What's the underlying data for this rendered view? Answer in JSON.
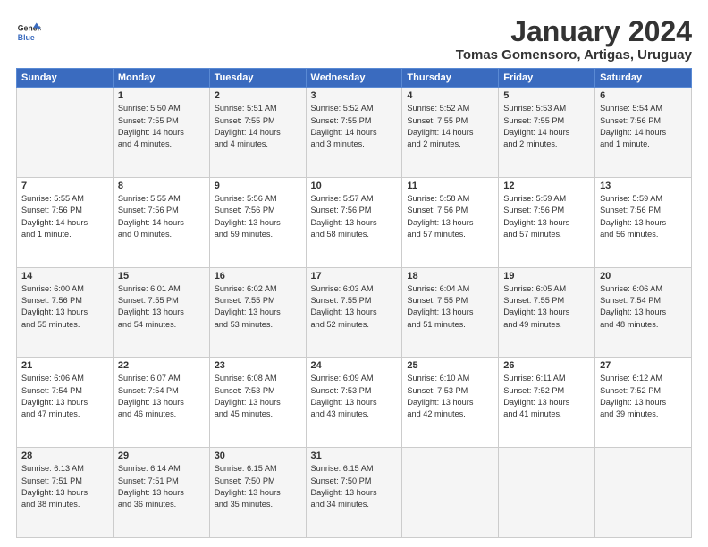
{
  "logo": {
    "line1": "General",
    "line2": "Blue"
  },
  "title": "January 2024",
  "subtitle": "Tomas Gomensoro, Artigas, Uruguay",
  "headers": [
    "Sunday",
    "Monday",
    "Tuesday",
    "Wednesday",
    "Thursday",
    "Friday",
    "Saturday"
  ],
  "rows": [
    [
      {
        "num": "",
        "lines": []
      },
      {
        "num": "1",
        "lines": [
          "Sunrise: 5:50 AM",
          "Sunset: 7:55 PM",
          "Daylight: 14 hours",
          "and 4 minutes."
        ]
      },
      {
        "num": "2",
        "lines": [
          "Sunrise: 5:51 AM",
          "Sunset: 7:55 PM",
          "Daylight: 14 hours",
          "and 4 minutes."
        ]
      },
      {
        "num": "3",
        "lines": [
          "Sunrise: 5:52 AM",
          "Sunset: 7:55 PM",
          "Daylight: 14 hours",
          "and 3 minutes."
        ]
      },
      {
        "num": "4",
        "lines": [
          "Sunrise: 5:52 AM",
          "Sunset: 7:55 PM",
          "Daylight: 14 hours",
          "and 2 minutes."
        ]
      },
      {
        "num": "5",
        "lines": [
          "Sunrise: 5:53 AM",
          "Sunset: 7:55 PM",
          "Daylight: 14 hours",
          "and 2 minutes."
        ]
      },
      {
        "num": "6",
        "lines": [
          "Sunrise: 5:54 AM",
          "Sunset: 7:56 PM",
          "Daylight: 14 hours",
          "and 1 minute."
        ]
      }
    ],
    [
      {
        "num": "7",
        "lines": [
          "Sunrise: 5:55 AM",
          "Sunset: 7:56 PM",
          "Daylight: 14 hours",
          "and 1 minute."
        ]
      },
      {
        "num": "8",
        "lines": [
          "Sunrise: 5:55 AM",
          "Sunset: 7:56 PM",
          "Daylight: 14 hours",
          "and 0 minutes."
        ]
      },
      {
        "num": "9",
        "lines": [
          "Sunrise: 5:56 AM",
          "Sunset: 7:56 PM",
          "Daylight: 13 hours",
          "and 59 minutes."
        ]
      },
      {
        "num": "10",
        "lines": [
          "Sunrise: 5:57 AM",
          "Sunset: 7:56 PM",
          "Daylight: 13 hours",
          "and 58 minutes."
        ]
      },
      {
        "num": "11",
        "lines": [
          "Sunrise: 5:58 AM",
          "Sunset: 7:56 PM",
          "Daylight: 13 hours",
          "and 57 minutes."
        ]
      },
      {
        "num": "12",
        "lines": [
          "Sunrise: 5:59 AM",
          "Sunset: 7:56 PM",
          "Daylight: 13 hours",
          "and 57 minutes."
        ]
      },
      {
        "num": "13",
        "lines": [
          "Sunrise: 5:59 AM",
          "Sunset: 7:56 PM",
          "Daylight: 13 hours",
          "and 56 minutes."
        ]
      }
    ],
    [
      {
        "num": "14",
        "lines": [
          "Sunrise: 6:00 AM",
          "Sunset: 7:56 PM",
          "Daylight: 13 hours",
          "and 55 minutes."
        ]
      },
      {
        "num": "15",
        "lines": [
          "Sunrise: 6:01 AM",
          "Sunset: 7:55 PM",
          "Daylight: 13 hours",
          "and 54 minutes."
        ]
      },
      {
        "num": "16",
        "lines": [
          "Sunrise: 6:02 AM",
          "Sunset: 7:55 PM",
          "Daylight: 13 hours",
          "and 53 minutes."
        ]
      },
      {
        "num": "17",
        "lines": [
          "Sunrise: 6:03 AM",
          "Sunset: 7:55 PM",
          "Daylight: 13 hours",
          "and 52 minutes."
        ]
      },
      {
        "num": "18",
        "lines": [
          "Sunrise: 6:04 AM",
          "Sunset: 7:55 PM",
          "Daylight: 13 hours",
          "and 51 minutes."
        ]
      },
      {
        "num": "19",
        "lines": [
          "Sunrise: 6:05 AM",
          "Sunset: 7:55 PM",
          "Daylight: 13 hours",
          "and 49 minutes."
        ]
      },
      {
        "num": "20",
        "lines": [
          "Sunrise: 6:06 AM",
          "Sunset: 7:54 PM",
          "Daylight: 13 hours",
          "and 48 minutes."
        ]
      }
    ],
    [
      {
        "num": "21",
        "lines": [
          "Sunrise: 6:06 AM",
          "Sunset: 7:54 PM",
          "Daylight: 13 hours",
          "and 47 minutes."
        ]
      },
      {
        "num": "22",
        "lines": [
          "Sunrise: 6:07 AM",
          "Sunset: 7:54 PM",
          "Daylight: 13 hours",
          "and 46 minutes."
        ]
      },
      {
        "num": "23",
        "lines": [
          "Sunrise: 6:08 AM",
          "Sunset: 7:53 PM",
          "Daylight: 13 hours",
          "and 45 minutes."
        ]
      },
      {
        "num": "24",
        "lines": [
          "Sunrise: 6:09 AM",
          "Sunset: 7:53 PM",
          "Daylight: 13 hours",
          "and 43 minutes."
        ]
      },
      {
        "num": "25",
        "lines": [
          "Sunrise: 6:10 AM",
          "Sunset: 7:53 PM",
          "Daylight: 13 hours",
          "and 42 minutes."
        ]
      },
      {
        "num": "26",
        "lines": [
          "Sunrise: 6:11 AM",
          "Sunset: 7:52 PM",
          "Daylight: 13 hours",
          "and 41 minutes."
        ]
      },
      {
        "num": "27",
        "lines": [
          "Sunrise: 6:12 AM",
          "Sunset: 7:52 PM",
          "Daylight: 13 hours",
          "and 39 minutes."
        ]
      }
    ],
    [
      {
        "num": "28",
        "lines": [
          "Sunrise: 6:13 AM",
          "Sunset: 7:51 PM",
          "Daylight: 13 hours",
          "and 38 minutes."
        ]
      },
      {
        "num": "29",
        "lines": [
          "Sunrise: 6:14 AM",
          "Sunset: 7:51 PM",
          "Daylight: 13 hours",
          "and 36 minutes."
        ]
      },
      {
        "num": "30",
        "lines": [
          "Sunrise: 6:15 AM",
          "Sunset: 7:50 PM",
          "Daylight: 13 hours",
          "and 35 minutes."
        ]
      },
      {
        "num": "31",
        "lines": [
          "Sunrise: 6:15 AM",
          "Sunset: 7:50 PM",
          "Daylight: 13 hours",
          "and 34 minutes."
        ]
      },
      {
        "num": "",
        "lines": []
      },
      {
        "num": "",
        "lines": []
      },
      {
        "num": "",
        "lines": []
      }
    ]
  ]
}
